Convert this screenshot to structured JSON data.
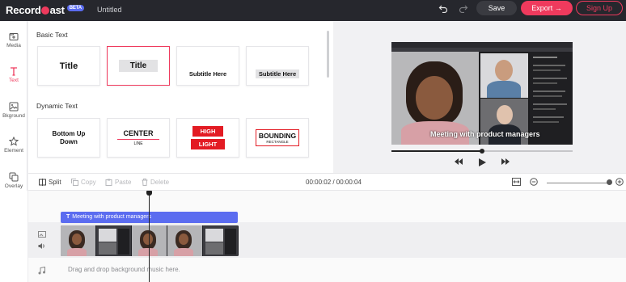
{
  "app": {
    "logo_prefix": "Record",
    "logo_suffix": "ast",
    "badge": "BETA",
    "project_title": "Untitled",
    "accent": "#ef3a5d",
    "brand_blue": "#5b6cf0"
  },
  "topbar": {
    "undo_icon": "undo-icon",
    "redo_icon": "redo-icon",
    "save_label": "Save",
    "export_label": "Export",
    "signup_label": "Sign Up"
  },
  "rail": {
    "items": [
      {
        "label": "Media",
        "icon": "media-icon"
      },
      {
        "label": "Text",
        "icon": "text-icon"
      },
      {
        "label": "Bkground",
        "icon": "background-icon"
      },
      {
        "label": "Element",
        "icon": "star-icon"
      },
      {
        "label": "Overlay",
        "icon": "overlay-icon"
      }
    ]
  },
  "panel": {
    "basic_title": "Basic Text",
    "dynamic_title": "Dynamic Text",
    "basic_cards": [
      "Title",
      "Title",
      "Subtitle Here",
      "Subtitle Here"
    ],
    "dynamic_cards": {
      "bottom_up": "Bottom Up Down",
      "center_top": "CENTER",
      "center_bottom": "LINE",
      "high": "HIGH",
      "light": "LIGHT",
      "bounding_top": "BOUNDING",
      "bounding_bottom": "RECTANGLE"
    }
  },
  "preview": {
    "caption": "Meeting with product managers",
    "progress": 0.5
  },
  "toolbar": {
    "split": "Split",
    "copy": "Copy",
    "paste": "Paste",
    "delete": "Delete",
    "timecode": "00:00:02 / 00:00:04"
  },
  "timeline": {
    "text_clip": "Meeting with product managers",
    "dropzone": "Drag and drop background music here."
  }
}
